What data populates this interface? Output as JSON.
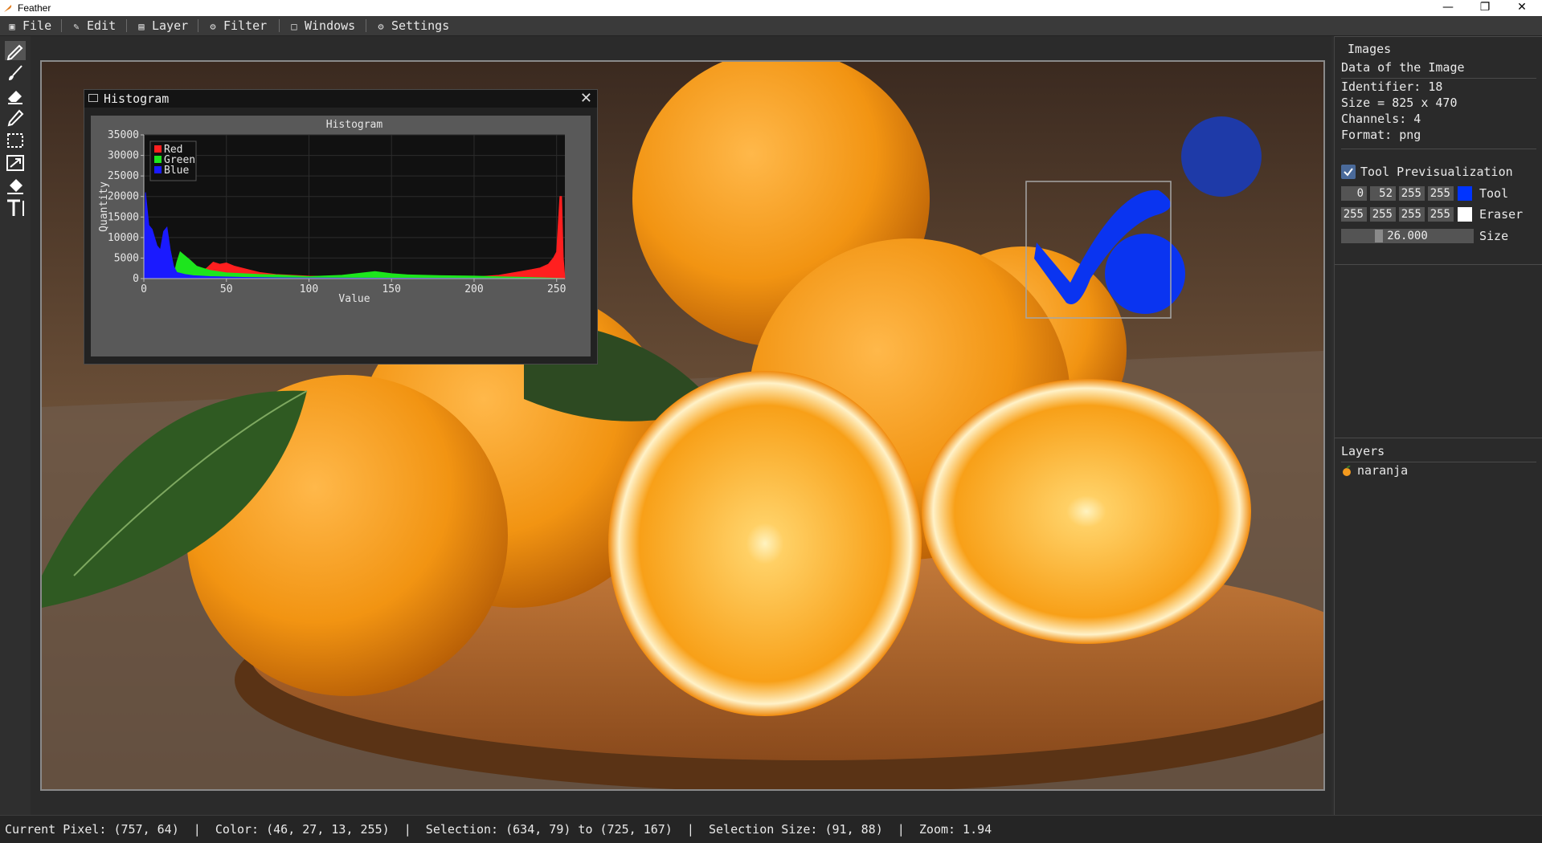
{
  "window": {
    "title": "Feather",
    "minimize": "—",
    "restore": "❐",
    "close": "✕"
  },
  "menu": [
    {
      "label": "File",
      "icon": "file-icon"
    },
    {
      "label": "Edit",
      "icon": "edit-icon"
    },
    {
      "label": "Layer",
      "icon": "layer-icon"
    },
    {
      "label": "Filter",
      "icon": "filter-icon"
    },
    {
      "label": "Windows",
      "icon": "windows-icon"
    },
    {
      "label": "Settings",
      "icon": "settings-icon"
    }
  ],
  "tools": [
    "pencil-icon",
    "brush-icon",
    "eraser-icon",
    "eyedropper-icon",
    "selection-rect-icon",
    "resize-icon",
    "fill-bucket-icon",
    "text-tool-icon"
  ],
  "histogram_window": {
    "title": "Histogram",
    "close": "✕"
  },
  "chart_data": {
    "type": "area",
    "title": "Histogram",
    "xlabel": "Value",
    "ylabel": "Quantity",
    "xlim": [
      0,
      255
    ],
    "ylim": [
      0,
      35000
    ],
    "xticks": [
      0,
      50,
      100,
      150,
      200,
      250
    ],
    "yticks": [
      0,
      5000,
      10000,
      15000,
      20000,
      25000,
      30000,
      35000
    ],
    "grid": true,
    "legend_position": "top-left",
    "series": [
      {
        "name": "Red",
        "color": "#ff1f1f",
        "x": [
          0,
          5,
          10,
          20,
          30,
          38,
          42,
          46,
          50,
          55,
          60,
          70,
          80,
          100,
          120,
          140,
          160,
          180,
          200,
          215,
          225,
          235,
          240,
          245,
          248,
          250,
          252,
          253,
          254,
          255
        ],
        "y": [
          0,
          0,
          0,
          0,
          500,
          2500,
          4000,
          3500,
          3800,
          3000,
          2500,
          1500,
          1000,
          600,
          500,
          700,
          600,
          500,
          400,
          800,
          1500,
          2200,
          2600,
          3500,
          5000,
          6500,
          20000,
          20000,
          5000,
          0
        ]
      },
      {
        "name": "Green",
        "color": "#1de51d",
        "x": [
          0,
          10,
          18,
          20,
          22,
          25,
          28,
          32,
          36,
          40,
          50,
          60,
          70,
          80,
          90,
          100,
          120,
          140,
          150,
          160,
          180,
          200,
          220,
          240,
          255
        ],
        "y": [
          0,
          0,
          500,
          4000,
          6500,
          5500,
          4500,
          3000,
          2500,
          2000,
          1400,
          1200,
          1000,
          900,
          700,
          500,
          800,
          1700,
          1200,
          900,
          700,
          600,
          400,
          200,
          0
        ]
      },
      {
        "name": "Blue",
        "color": "#1a1aff",
        "x": [
          0,
          1,
          3,
          5,
          8,
          10,
          12,
          14,
          16,
          18,
          20,
          25,
          30,
          40,
          50,
          60,
          80,
          100,
          150,
          200,
          255
        ],
        "y": [
          0,
          21000,
          13000,
          12000,
          8000,
          7000,
          11500,
          12500,
          7000,
          3000,
          1500,
          1000,
          700,
          500,
          400,
          300,
          200,
          150,
          100,
          50,
          0
        ]
      }
    ]
  },
  "images_panel": {
    "title": "Images",
    "subtitle": "Data of the Image",
    "identifier": "Identifier: 18",
    "size": "Size = 825 x 470",
    "channels": "Channels: 4",
    "format": "Format: png"
  },
  "tool_panel": {
    "previsualization_label": "Tool Previsualization",
    "previsualization_checked": true,
    "tool_label": "Tool",
    "tool_color": [
      "0",
      "52",
      "255",
      "255"
    ],
    "tool_swatch_color": "#0034ff",
    "eraser_label": "Eraser",
    "eraser_color": [
      "255",
      "255",
      "255",
      "255"
    ],
    "eraser_swatch_color": "#ffffff",
    "size_label": "Size",
    "size_value": "26.000",
    "size_level": 0.26
  },
  "layers_panel": {
    "title": "Layers",
    "items": [
      {
        "name": "naranja",
        "icon": "orange-layer-icon"
      }
    ]
  },
  "status": {
    "text": "Current Pixel: (757, 64)  |  Color: (46, 27, 13, 255)  |  Selection: (634, 79) to (725, 167)  |  Selection Size: (91, 88)  |  Zoom: 1.94"
  }
}
